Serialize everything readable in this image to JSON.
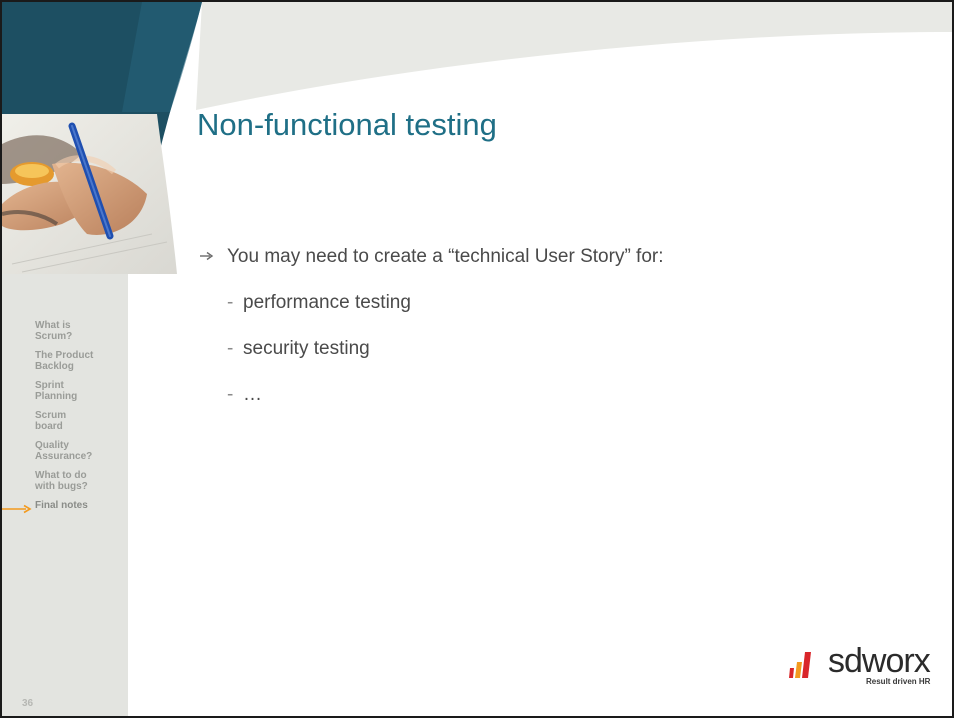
{
  "slide": {
    "title": "Non-functional testing",
    "page_number": "36",
    "bullets": [
      {
        "text": "You may need to create a “technical User Story” for:"
      }
    ],
    "sub_bullets": [
      {
        "dash": "-",
        "text": "performance testing"
      },
      {
        "dash": "-",
        "text": "security testing"
      },
      {
        "dash": "-",
        "text": "…"
      }
    ]
  },
  "sidebar": {
    "items": [
      {
        "label": "What is\nScrum?"
      },
      {
        "label": "The Product\nBacklog"
      },
      {
        "label": "Sprint\nPlanning"
      },
      {
        "label": "Scrum\nboard"
      },
      {
        "label": "Quality\nAssurance?"
      },
      {
        "label": "What to do\nwith bugs?"
      },
      {
        "label": "Final notes"
      }
    ],
    "active_index": 6
  },
  "logo": {
    "wordmark": "sdworx",
    "tagline": "Result driven HR"
  },
  "colors": {
    "teal_dark": "#1d4f62",
    "title": "#1f6f86",
    "arrow": "#f39a1e",
    "logo_red": "#d9262a",
    "logo_orange": "#f39a1e"
  }
}
